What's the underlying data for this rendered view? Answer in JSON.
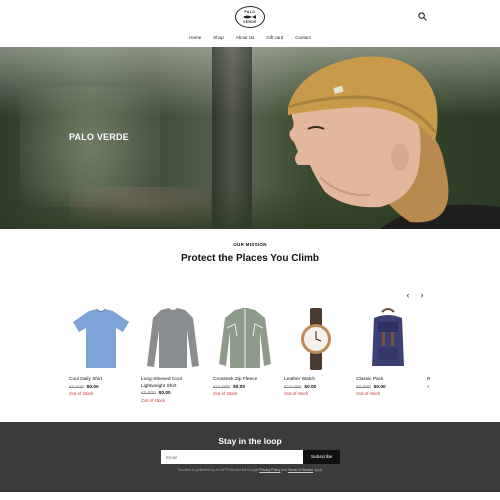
{
  "header": {
    "logo_top": "PALO",
    "logo_bottom": "VERDE",
    "search_icon": "search-icon",
    "nav": [
      "Home",
      "Shop",
      "About Us",
      "Gift card",
      "Contact"
    ]
  },
  "hero": {
    "title": "PALO VERDE"
  },
  "mission": {
    "label": "OUR MISSION",
    "title": "Protect the Places You Climb"
  },
  "carousel": {
    "prev_icon": "chevron-left-icon",
    "next_icon": "chevron-right-icon"
  },
  "products": [
    {
      "name": "Cool Daily Shirt",
      "old_price": "€2,000",
      "price": "$0.00",
      "stock": "Out of stock",
      "color": "#7ea3d6"
    },
    {
      "name": "Long-Sleeved Cool Lightweight Shirt",
      "old_price": "€5,000",
      "price": "$0.00",
      "stock": "Out of stock",
      "color": "#8a8d90"
    },
    {
      "name": "Crosstrek Zip Fleece",
      "old_price": "€11,000",
      "price": "$0.00",
      "stock": "Out of stock",
      "color": "#8f9b8a"
    },
    {
      "name": "Leather Watch",
      "old_price": "€12,000",
      "price": "$0.00",
      "stock": "Out of stock",
      "color": "#5a3b22"
    },
    {
      "name": "Classic Pack",
      "old_price": "€5,000",
      "price": "$0.00",
      "stock": "Out of stock",
      "color": "#3c3f73"
    }
  ],
  "partial_product": {
    "name": "R",
    "price": "€"
  },
  "footer": {
    "title": "Stay in the loop",
    "email_placeholder": "Email",
    "subscribe_label": "Subscribe",
    "captcha_pre": "This form is protected by reCAPTCHA and the Google ",
    "privacy": "Privacy Policy",
    "and": " and ",
    "terms": "Terms of Service",
    "captcha_post": " apply."
  }
}
